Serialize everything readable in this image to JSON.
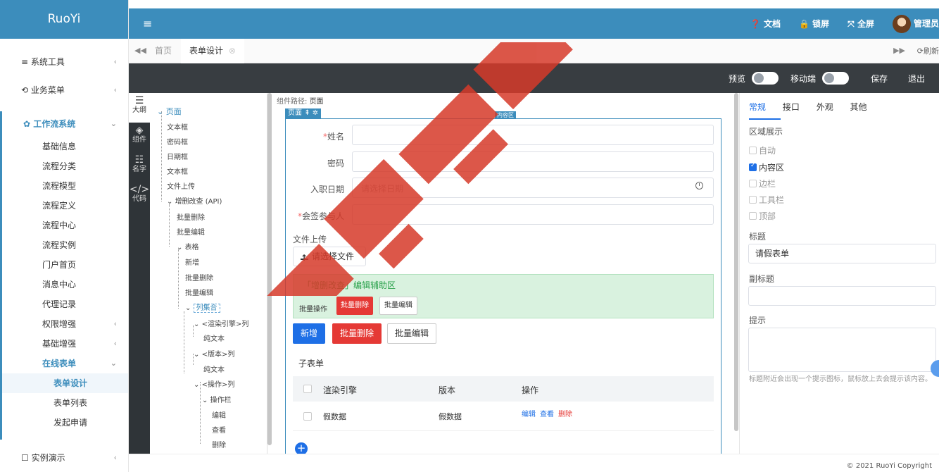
{
  "app": {
    "logo": "RuoYi"
  },
  "sidebar": {
    "top_items": [
      {
        "label": "≡ 系统工具"
      },
      {
        "label": "⟲ 业务菜单"
      }
    ],
    "active_group": "✿ 工作流系统",
    "sub_items": [
      "基础信息",
      "流程分类",
      "流程模型",
      "流程定义",
      "流程中心",
      "流程实例",
      "门户首页",
      "消息中心",
      "代理记录",
      "权限增强",
      "基础增强",
      "在线表单"
    ],
    "subsub_items": [
      "表单设计",
      "表单列表",
      "发起申请"
    ],
    "bottom_item": "☐ 实例演示"
  },
  "topbar": {
    "menu_icon": "≡",
    "docs": "文档",
    "lock": "锁屏",
    "fullscreen": "全屏",
    "user": "管理员"
  },
  "tabs": {
    "home": "首页",
    "active": "表单设计",
    "refresh": "刷新"
  },
  "designer_bar": {
    "preview": "预览",
    "mobile": "移动端",
    "save": "保存",
    "exit": "退出"
  },
  "icon_strip": [
    "大纲",
    "组件",
    "名字",
    "代码"
  ],
  "tree": {
    "root": "页面",
    "nodes": [
      "文本框",
      "密码框",
      "日期框",
      "文本框",
      "文件上传",
      "增删改查 (API)",
      "批量删除",
      "批量编辑",
      "表格",
      "新增",
      "批量删除",
      "批量编辑",
      "列集合",
      "<渲染引擎>列",
      "纯文本",
      "<版本>列",
      "纯文本",
      "<操作>列",
      "操作栏",
      "编辑",
      "查看",
      "删除"
    ]
  },
  "canvas": {
    "path_label": "组件路径:",
    "path_value": "页面",
    "page_badge": "页面",
    "content_badge": "内容区",
    "fields": [
      {
        "label": "姓名",
        "required": true,
        "value": ""
      },
      {
        "label": "密码",
        "required": false,
        "value": ""
      },
      {
        "label": "入职日期",
        "required": false,
        "placeholder": "请选择日期"
      },
      {
        "label": "会签参与人",
        "required": true,
        "value": ""
      }
    ],
    "upload_label": "文件上传",
    "upload_button": "请选择文件",
    "helper_title": "「增删改查」编辑辅助区",
    "helper_text": "批量操作",
    "helper_delete": "批量删除",
    "helper_edit": "批量编辑",
    "btn_add": "新增",
    "btn_delete": "批量删除",
    "btn_edit": "批量编辑",
    "subtable_title": "子表单",
    "columns": [
      "渲染引擎",
      "版本",
      "操作"
    ],
    "row": {
      "engine": "假数据",
      "version": "假数据",
      "actions": [
        "编辑",
        "查看",
        "删除"
      ]
    },
    "add_icon": "+"
  },
  "right_panel": {
    "tabs": [
      "常规",
      "接口",
      "外观",
      "其他"
    ],
    "region_label": "区域展示",
    "regions": [
      {
        "label": "自动",
        "checked": false
      },
      {
        "label": "内容区",
        "checked": true
      },
      {
        "label": "边栏",
        "checked": false
      },
      {
        "label": "工具栏",
        "checked": false
      },
      {
        "label": "顶部",
        "checked": false
      }
    ],
    "title_label": "标题",
    "title_value": "请假表单",
    "subtitle_label": "副标题",
    "hint_label": "提示",
    "hint_note": "标题附近会出现一个提示图标，鼠标放上去会提示该内容。"
  },
  "footer": {
    "copyright": "© 2021 RuoYi Copyright"
  },
  "colors": {
    "primary": "#3c8dbc",
    "danger": "#e53935",
    "action": "#1e6fe6",
    "dark": "#383d41"
  }
}
